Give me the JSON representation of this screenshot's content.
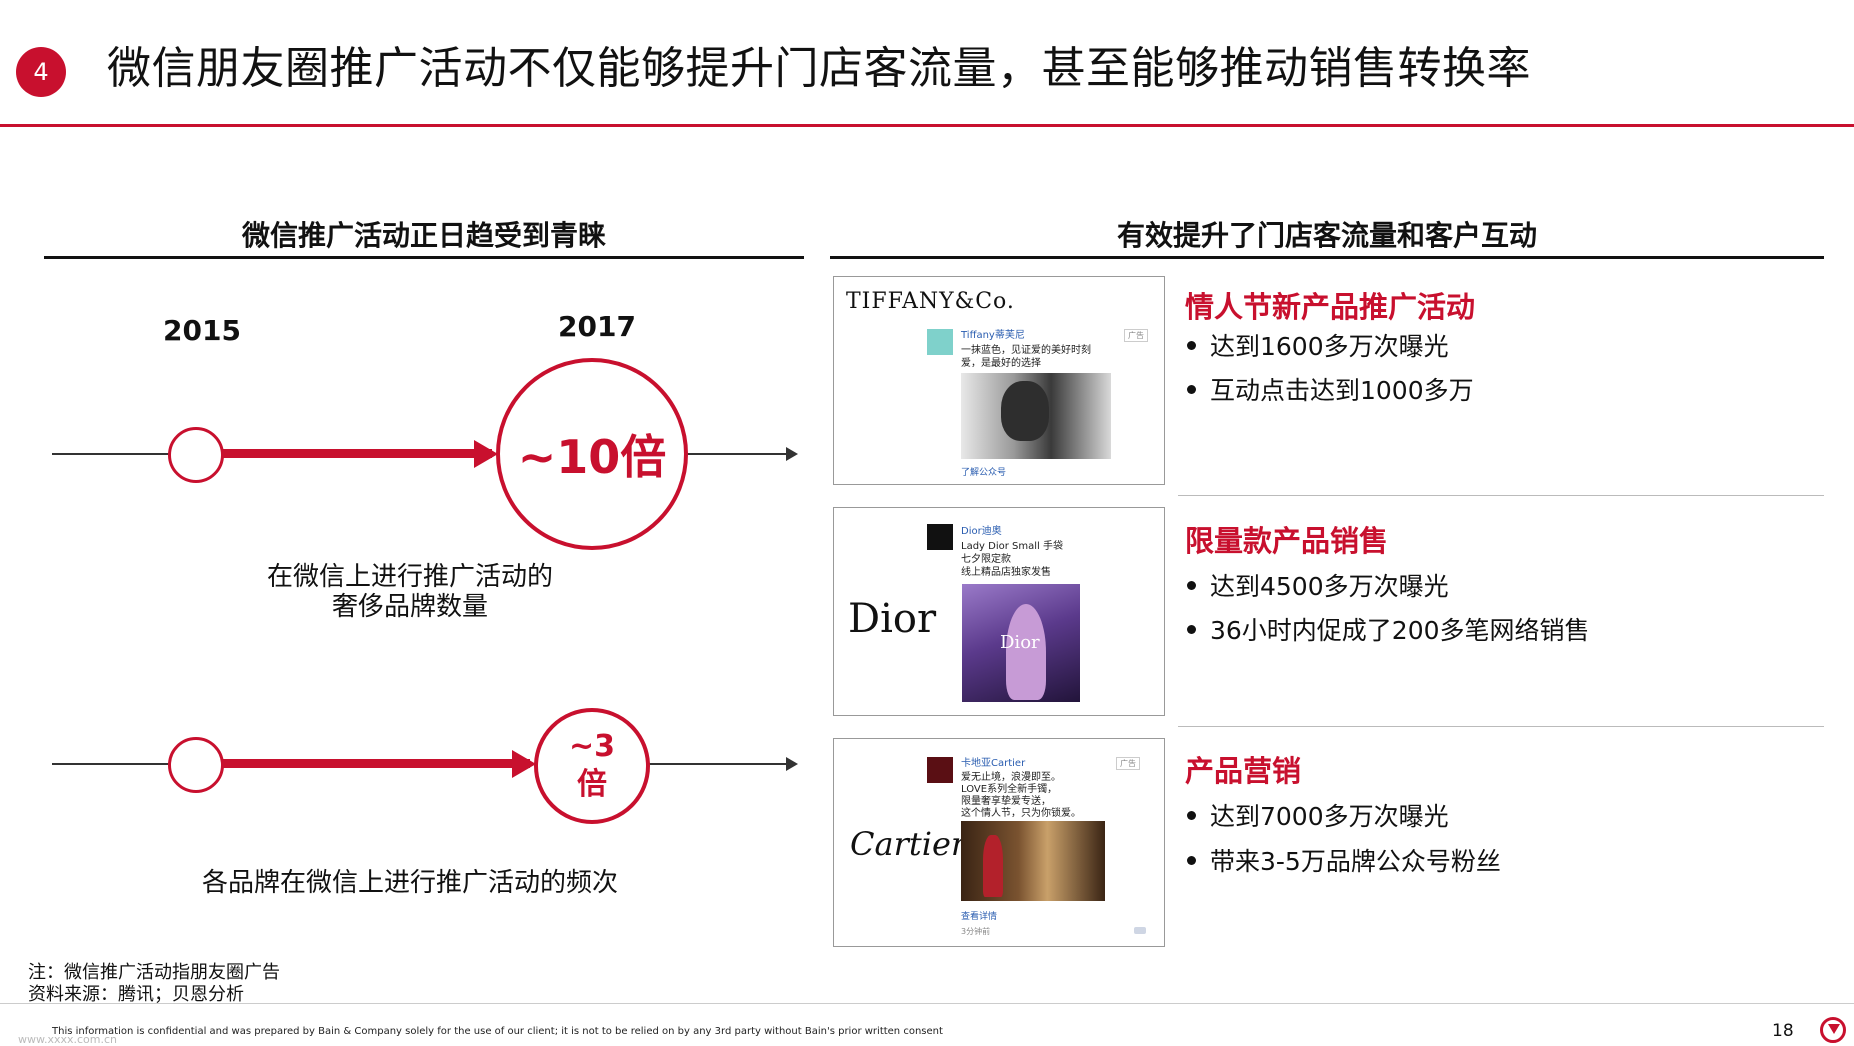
{
  "header": {
    "badge": "4",
    "title": "微信朋友圈推广活动不仅能够提升门店客流量，甚至能够推动销售转换率"
  },
  "left": {
    "heading": "微信推广活动正日趋受到青睐",
    "year_start": "2015",
    "year_end": "2017",
    "chart1_value": "~10倍",
    "chart1_caption_line1": "在微信上进行推广活动的",
    "chart1_caption_line2": "奢侈品牌数量",
    "chart2_value_line1": "~3",
    "chart2_value_line2": "倍",
    "chart2_caption": "各品牌在微信上进行推广活动的频次"
  },
  "right": {
    "heading": "有效提升了门店客流量和客户互动",
    "cases": [
      {
        "brand": "TIFFANY&Co.",
        "post_name": "Tiffany蒂芙尼",
        "post_lines": [
          "一抹蓝色，见证爱的美好时刻",
          "爱，是最好的选择"
        ],
        "ad_tag": "广告",
        "post_link": "了解公众号",
        "title": "情人节新产品推广活动",
        "bullets": [
          "达到1600多万次曝光",
          "互动点击达到1000多万"
        ]
      },
      {
        "brand": "Dior",
        "post_name": "Dior迪奥",
        "post_lines": [
          "Lady Dior Small 手袋",
          "七夕限定款",
          "线上精品店独家发售"
        ],
        "image_text": "Dior",
        "title": "限量款产品销售",
        "bullets": [
          "达到4500多万次曝光",
          "36小时内促成了200多笔网络销售"
        ]
      },
      {
        "brand": "Cartier",
        "post_name": "卡地亚Cartier",
        "post_lines": [
          "爱无止境，浪漫即至。",
          "LOVE系列全新手镯，",
          "限量奢享挚爱专送，",
          "这个情人节，只为你锁爱。"
        ],
        "ad_tag": "广告",
        "post_link": "查看详情",
        "post_time": "3分钟前",
        "title": "产品营销",
        "bullets": [
          "达到7000多万次曝光",
          "带来3-5万品牌公众号粉丝"
        ]
      }
    ]
  },
  "footer": {
    "note_line1": "注：微信推广活动指朋友圈广告",
    "note_line2": "资料来源：腾讯；贝恩分析",
    "confidential": "This information is confidential and was prepared by Bain & Company solely for the use of our client; it is not to be relied on by any 3rd party without Bain's prior written consent",
    "watermark": "www.xxxx.com.cn",
    "page_number": "18"
  },
  "colors": {
    "accent": "#c8102e",
    "text": "#111111",
    "link": "#2a5db0"
  }
}
